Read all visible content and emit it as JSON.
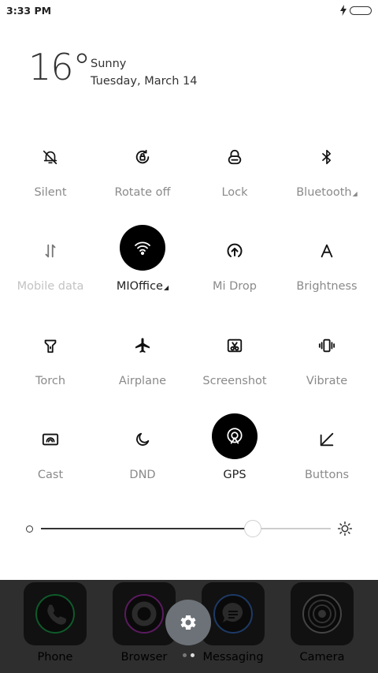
{
  "status": {
    "time": "3:33 PM"
  },
  "weather": {
    "temp": "16°",
    "condition": "Sunny",
    "date": "Tuesday, March 14"
  },
  "toggles": [
    {
      "label": "Silent",
      "icon": "bell-off-icon",
      "state": "off"
    },
    {
      "label": "Rotate off",
      "icon": "rotate-lock-icon",
      "state": "off"
    },
    {
      "label": "Lock",
      "icon": "lock-icon",
      "state": "off"
    },
    {
      "label": "Bluetooth",
      "icon": "bluetooth-icon",
      "state": "off"
    },
    {
      "label": "Mobile data",
      "icon": "mobile-data-icon",
      "state": "disabled"
    },
    {
      "label": "MIOffice",
      "icon": "wifi-icon",
      "state": "on"
    },
    {
      "label": "Mi Drop",
      "icon": "mi-drop-icon",
      "state": "off"
    },
    {
      "label": "Brightness",
      "icon": "auto-brightness-icon",
      "state": "off"
    },
    {
      "label": "Torch",
      "icon": "torch-icon",
      "state": "off"
    },
    {
      "label": "Airplane",
      "icon": "airplane-icon",
      "state": "off"
    },
    {
      "label": "Screenshot",
      "icon": "screenshot-icon",
      "state": "off"
    },
    {
      "label": "Vibrate",
      "icon": "vibrate-icon",
      "state": "off"
    },
    {
      "label": "Cast",
      "icon": "cast-icon",
      "state": "off"
    },
    {
      "label": "DND",
      "icon": "moon-icon",
      "state": "off"
    },
    {
      "label": "GPS",
      "icon": "gps-icon",
      "state": "on"
    },
    {
      "label": "Buttons",
      "icon": "buttons-icon",
      "state": "off"
    }
  ],
  "brightness": {
    "level": 0.73
  },
  "dock": [
    {
      "label": "Phone",
      "icon": "phone-icon",
      "ring": "#0f5a2a"
    },
    {
      "label": "Browser",
      "icon": "browser-icon",
      "ring": "#5a1b5f"
    },
    {
      "label": "Messaging",
      "icon": "messaging-icon",
      "ring": "#1d3a66"
    },
    {
      "label": "Camera",
      "icon": "camera-icon",
      "ring": "#444444"
    }
  ],
  "colors": {
    "active_bg": "#000000",
    "dock_bg": "#2e2e2e",
    "fab_bg": "#6c7278"
  }
}
